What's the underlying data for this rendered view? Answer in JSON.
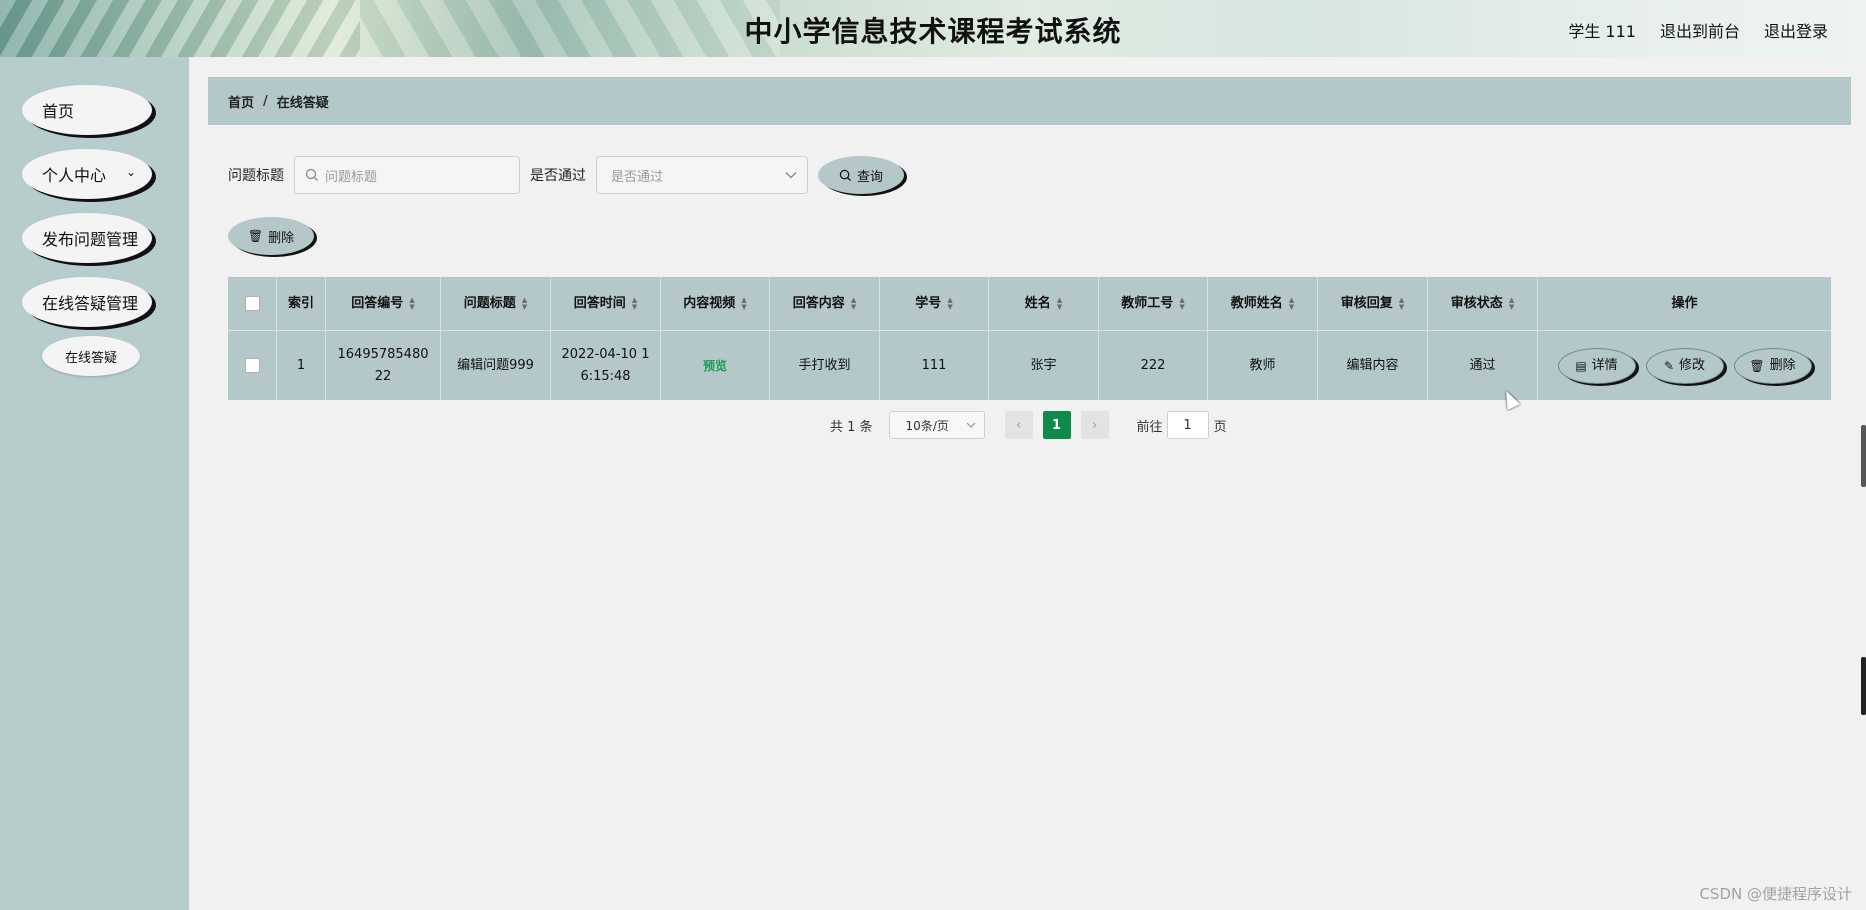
{
  "header": {
    "title": "中小学信息技术课程考试系统",
    "user": "学生 111",
    "front_link": "退出到前台",
    "logout_link": "退出登录"
  },
  "sidebar": {
    "items": [
      {
        "label": "首页"
      },
      {
        "label": "个人中心"
      },
      {
        "label": "发布问题管理"
      },
      {
        "label": "在线答疑管理"
      }
    ],
    "subitem": "在线答疑"
  },
  "breadcrumb": {
    "home": "首页",
    "sep": "/",
    "current": "在线答疑"
  },
  "search": {
    "title_label": "问题标题",
    "title_placeholder": "问题标题",
    "pass_label": "是否通过",
    "pass_placeholder": "是否通过",
    "query_button": "查询"
  },
  "toolbar": {
    "delete_button": "删除"
  },
  "table": {
    "headers": [
      "索引",
      "回答编号",
      "问题标题",
      "回答时间",
      "内容视频",
      "回答内容",
      "学号",
      "姓名",
      "教师工号",
      "教师姓名",
      "审核回复",
      "审核状态",
      "操作"
    ],
    "rows": [
      {
        "index": "1",
        "answer_no": "1649578548022",
        "title": "编辑问题999",
        "time": "2022-04-10 16:15:48",
        "video": "预览",
        "content": "手打收到",
        "student_no": "111",
        "name": "张宇",
        "teacher_no": "222",
        "teacher_name": "教师",
        "review_reply": "编辑内容",
        "review_status": "通过",
        "ops": {
          "detail": "详情",
          "edit": "修改",
          "delete": "删除"
        }
      }
    ]
  },
  "pagination": {
    "total": "共 1 条",
    "page_size": "10条/页",
    "current_page": "1",
    "goto_label": "前往",
    "goto_value": "1",
    "page_suffix": "页"
  },
  "watermark": "CSDN @便捷程序设计"
}
